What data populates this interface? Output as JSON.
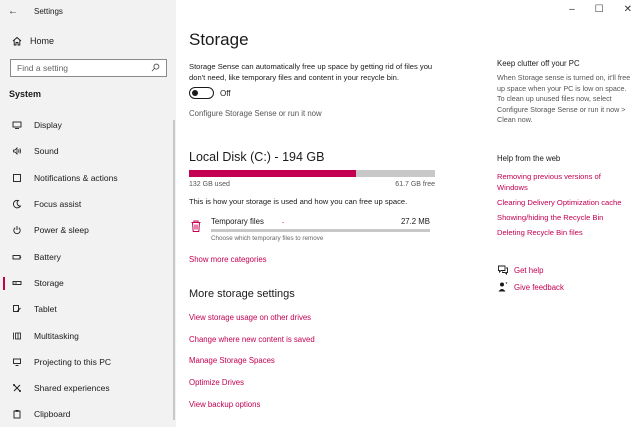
{
  "window": {
    "title": "Settings",
    "controls": [
      "–",
      "☐",
      "✕"
    ]
  },
  "sidebar": {
    "home": "Home",
    "search_placeholder": "Find a setting",
    "section": "System",
    "items": [
      {
        "label": "Display",
        "icon": "display-icon"
      },
      {
        "label": "Sound",
        "icon": "sound-icon"
      },
      {
        "label": "Notifications & actions",
        "icon": "notifications-icon"
      },
      {
        "label": "Focus assist",
        "icon": "moon-icon"
      },
      {
        "label": "Power & sleep",
        "icon": "power-icon"
      },
      {
        "label": "Battery",
        "icon": "battery-icon"
      },
      {
        "label": "Storage",
        "icon": "storage-icon",
        "active": true
      },
      {
        "label": "Tablet",
        "icon": "tablet-icon"
      },
      {
        "label": "Multitasking",
        "icon": "multitasking-icon"
      },
      {
        "label": "Projecting to this PC",
        "icon": "projecting-icon"
      },
      {
        "label": "Shared experiences",
        "icon": "shared-icon"
      },
      {
        "label": "Clipboard",
        "icon": "clipboard-icon"
      }
    ]
  },
  "main": {
    "title": "Storage",
    "description": "Storage Sense can automatically free up space by getting rid of files you don't need, like temporary files and content in your recycle bin.",
    "toggle_state": "Off",
    "configure_link": "Configure Storage Sense or run it now",
    "disk_title": "Local Disk (C:) - 194 GB",
    "used_label": "132 GB used",
    "free_label": "61.7 GB free",
    "used_fraction": 0.68,
    "how_text": "This is how your storage is used and how you can free up space.",
    "temp": {
      "name": "Temporary files",
      "size": "27.2 MB",
      "hint": "Choose which temporary files to remove",
      "fraction": 0.0
    },
    "show_more": "Show more categories",
    "more_title": "More storage settings",
    "more_links": [
      "View storage usage on other drives",
      "Change where new content is saved",
      "Manage Storage Spaces",
      "Optimize Drives",
      "View backup options"
    ]
  },
  "right": {
    "clutter_title": "Keep clutter off your PC",
    "clutter_desc": "When Storage sense is turned on, it'll free up space when your PC is low on space. To clean up unused files now, select Configure Storage Sense or run it now > Clean now.",
    "help_title": "Help from the web",
    "web_links": [
      "Removing previous versions of Windows",
      "Clearing Delivery Optimization cache",
      "Showing/hiding the Recycle Bin",
      "Deleting Recycle Bin files"
    ],
    "get_help": "Get help",
    "give_feedback": "Give feedback"
  },
  "colors": {
    "accent": "#c30052",
    "sidebar_bg": "#f2f2f2"
  }
}
